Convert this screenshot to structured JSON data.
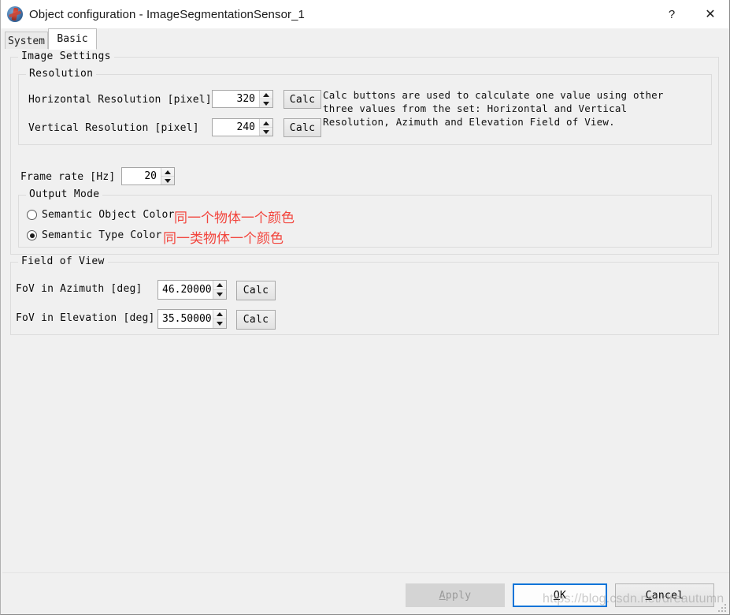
{
  "window": {
    "title": "Object configuration - ImageSegmentationSensor_1",
    "icon": "app-globe-icon",
    "help_button": "?",
    "close_button": "✕"
  },
  "tabs": [
    {
      "label": "System",
      "active": false
    },
    {
      "label": "Basic",
      "active": true
    }
  ],
  "image_settings": {
    "group_label": "Image Settings",
    "resolution": {
      "group_label": "Resolution",
      "horizontal": {
        "label": "Horizontal Resolution [pixel]",
        "value": "320",
        "calc_label": "Calc"
      },
      "vertical": {
        "label": "Vertical Resolution [pixel]",
        "value": "240",
        "calc_label": "Calc"
      },
      "help_text": "Calc buttons are used to calculate one value using other three values from the set: Horizontal and Vertical Resolution, Azimuth and Elevation Field of View."
    },
    "frame_rate": {
      "label": "Frame rate [Hz]",
      "value": "20"
    },
    "output_mode": {
      "group_label": "Output Mode",
      "options": [
        {
          "label": "Semantic Object Color",
          "selected": false,
          "annotation": "同一个物体一个颜色"
        },
        {
          "label": "Semantic Type Color",
          "selected": true,
          "annotation": "同一类物体一个颜色"
        }
      ]
    }
  },
  "field_of_view": {
    "group_label": "Field of View",
    "azimuth": {
      "label": "FoV in Azimuth [deg]",
      "value": "46.20000",
      "calc_label": "Calc"
    },
    "elevation": {
      "label": "FoV in Elevation [deg]",
      "value": "35.50000",
      "calc_label": "Calc"
    }
  },
  "footer": {
    "apply_label": "Apply",
    "apply_mnemonic": "A",
    "apply_rest": "pply",
    "ok_label": "OK",
    "ok_mnemonic": "O",
    "ok_rest": "K",
    "cancel_label": "Cancel",
    "cancel_mnemonic": "C",
    "cancel_rest": "ancel"
  },
  "watermark": "https://blog.csdn.net/dreautumn",
  "colors": {
    "annotation_red": "#f2453d",
    "focus_blue": "#0a74d8",
    "window_bg": "#f0f0f0"
  }
}
